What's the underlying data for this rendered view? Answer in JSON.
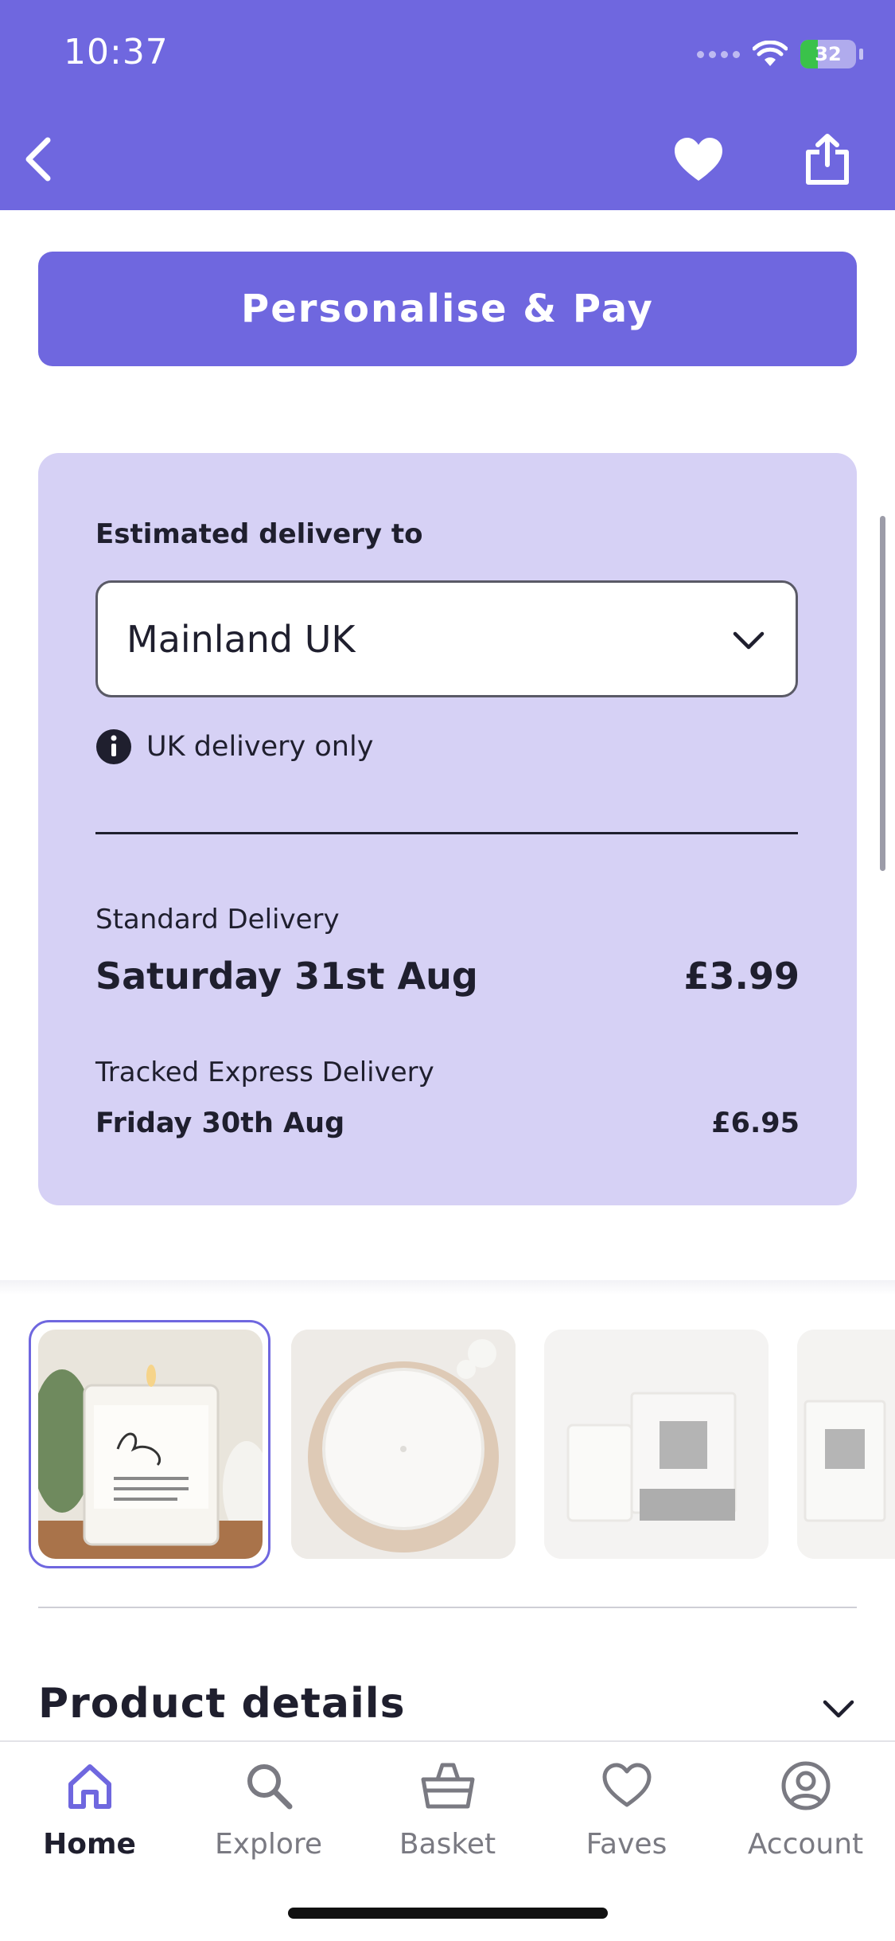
{
  "status_bar": {
    "time": "10:37",
    "battery": "32"
  },
  "colors": {
    "brand": "#6f67df",
    "card_bg": "#d6d1f5",
    "text": "#1f1f2e"
  },
  "header": {
    "back_icon": "chevron-left-icon",
    "favorite_icon": "heart-icon",
    "share_icon": "share-icon"
  },
  "cta": {
    "label": "Personalise & Pay"
  },
  "delivery": {
    "label": "Estimated delivery to",
    "region": "Mainland UK",
    "note": "UK delivery only",
    "options": [
      {
        "name": "Standard Delivery",
        "date": "Saturday 31st Aug",
        "price": "£3.99"
      },
      {
        "name": "Tracked Express Delivery",
        "date": "Friday 30th Aug",
        "price": "£6.95"
      }
    ]
  },
  "gallery": {
    "images": [
      {
        "alt": "Candle in glass jar with So proud label",
        "selected": true
      },
      {
        "alt": "Top view of white candle on wooden board",
        "selected": false
      },
      {
        "alt": "Candle packaging with matchbox",
        "selected": false
      },
      {
        "alt": "Candle gift box",
        "selected": false
      }
    ]
  },
  "product_details": {
    "title": "Product details"
  },
  "tabs": [
    {
      "label": "Home",
      "icon": "home-icon",
      "active": true
    },
    {
      "label": "Explore",
      "icon": "search-icon",
      "active": false
    },
    {
      "label": "Basket",
      "icon": "basket-icon",
      "active": false
    },
    {
      "label": "Faves",
      "icon": "heart-outline-icon",
      "active": false
    },
    {
      "label": "Account",
      "icon": "account-icon",
      "active": false
    }
  ]
}
